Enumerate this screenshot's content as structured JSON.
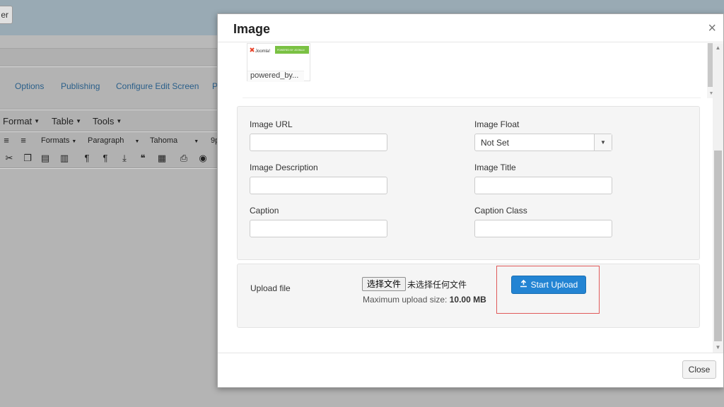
{
  "background": {
    "top_button_label": "er",
    "tabs": [
      "Options",
      "Publishing",
      "Configure Edit Screen",
      "P"
    ],
    "menus": [
      "Format",
      "Table",
      "Tools"
    ],
    "toolbar": {
      "formats_label": "Formats",
      "paragraph_label": "Paragraph",
      "font_label": "Tahoma",
      "size_label": "9p"
    }
  },
  "modal": {
    "title": "Image",
    "close_x": "×",
    "browser": {
      "thumb_name": "powered_by...",
      "thumb_logo_text": "Joomla!",
      "thumb_banner_text": "POWERED BY JOOMLA!"
    },
    "fields": {
      "image_url": {
        "label": "Image URL",
        "value": ""
      },
      "image_float": {
        "label": "Image Float",
        "value": "Not Set"
      },
      "image_description": {
        "label": "Image Description",
        "value": ""
      },
      "image_title": {
        "label": "Image Title",
        "value": ""
      },
      "caption": {
        "label": "Caption",
        "value": ""
      },
      "caption_class": {
        "label": "Caption Class",
        "value": ""
      }
    },
    "upload": {
      "label": "Upload file",
      "choose_file_label": "选择文件",
      "no_file_text": "未选择任何文件",
      "max_size_label": "Maximum upload size:",
      "max_size_value": "10.00 MB",
      "start_upload_label": "Start Upload"
    },
    "footer": {
      "close_label": "Close"
    }
  },
  "colors": {
    "primary_button": "#2384d3",
    "highlight_box": "#e05a5a",
    "joomla_green": "#7ac143"
  }
}
